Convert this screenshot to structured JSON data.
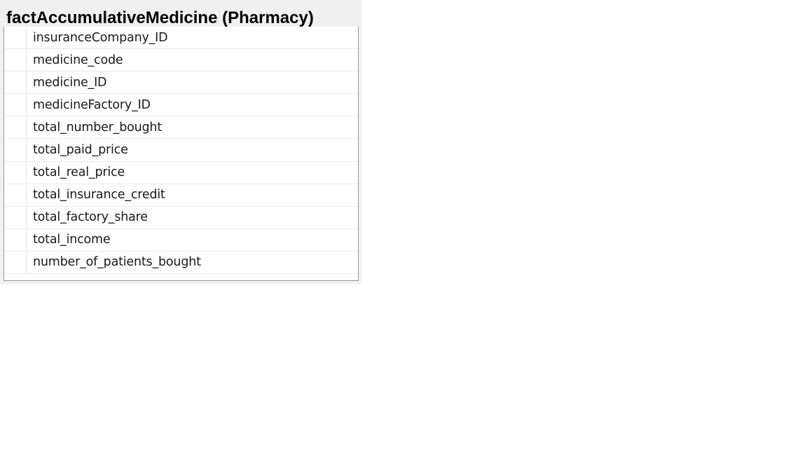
{
  "table": {
    "title": "factAccumulativeMedicine (Pharmacy)",
    "columns": [
      "insuranceCompany_ID",
      "medicine_code",
      "medicine_ID",
      "medicineFactory_ID",
      "total_number_bought",
      "total_paid_price",
      "total_real_price",
      "total_insurance_credit",
      "total_factory_share",
      "total_income",
      "number_of_patients_bought"
    ]
  }
}
